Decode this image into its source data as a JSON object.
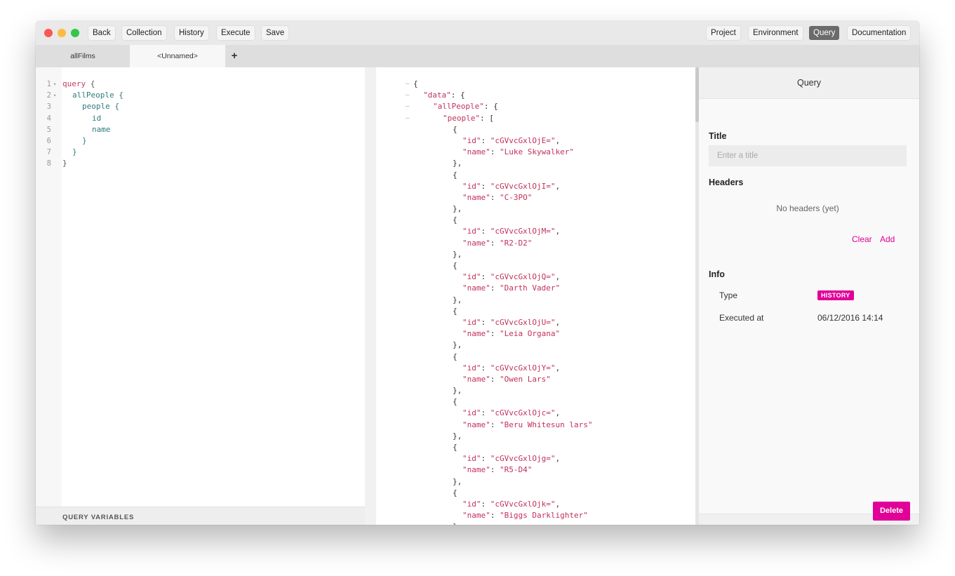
{
  "toolbar": {
    "left": [
      "Back",
      "Collection",
      "History",
      "Execute",
      "Save"
    ],
    "right": [
      "Project",
      "Environment",
      "Query",
      "Documentation"
    ],
    "active_right": "Query"
  },
  "tabs": {
    "items": [
      "allFilms",
      "<Unnamed>"
    ],
    "active_index": 1,
    "add_label": "+"
  },
  "query_editor": {
    "line_numbers": [
      "1",
      "2",
      "3",
      "4",
      "5",
      "6",
      "7",
      "8"
    ],
    "lines": [
      {
        "indent": 0,
        "text": "query {",
        "keyword": "query",
        "fold": true
      },
      {
        "indent": 1,
        "text": "allPeople {",
        "fold": true
      },
      {
        "indent": 2,
        "text": "people {"
      },
      {
        "indent": 3,
        "text": "id"
      },
      {
        "indent": 3,
        "text": "name"
      },
      {
        "indent": 2,
        "text": "}"
      },
      {
        "indent": 1,
        "text": "}"
      },
      {
        "indent": 0,
        "text": "}"
      }
    ],
    "variables_label": "QUERY VARIABLES"
  },
  "result": {
    "people": [
      {
        "id": "cGVvcGxlOjE=",
        "name": "Luke Skywalker"
      },
      {
        "id": "cGVvcGxlOjI=",
        "name": "C-3PO"
      },
      {
        "id": "cGVvcGxlOjM=",
        "name": "R2-D2"
      },
      {
        "id": "cGVvcGxlOjQ=",
        "name": "Darth Vader"
      },
      {
        "id": "cGVvcGxlOjU=",
        "name": "Leia Organa"
      },
      {
        "id": "cGVvcGxlOjY=",
        "name": "Owen Lars"
      },
      {
        "id": "cGVvcGxlOjc=",
        "name": "Beru Whitesun lars"
      },
      {
        "id": "cGVvcGxlOjg=",
        "name": "R5-D4"
      },
      {
        "id": "cGVvcGxlOjk=",
        "name": "Biggs Darklighter"
      }
    ]
  },
  "side_panel": {
    "header": "Query",
    "title_label": "Title",
    "title_placeholder": "Enter a title",
    "headers_label": "Headers",
    "no_headers": "No headers (yet)",
    "clear_label": "Clear",
    "add_label": "Add",
    "info_label": "Info",
    "type_label": "Type",
    "type_value": "HISTORY",
    "executed_label": "Executed at",
    "executed_value": "06/12/2016 14:14",
    "delete_label": "Delete"
  },
  "colors": {
    "accent": "#e10098",
    "keyword": "#c33d63",
    "field": "#2f7c7c",
    "json_value": "#c2305a"
  }
}
